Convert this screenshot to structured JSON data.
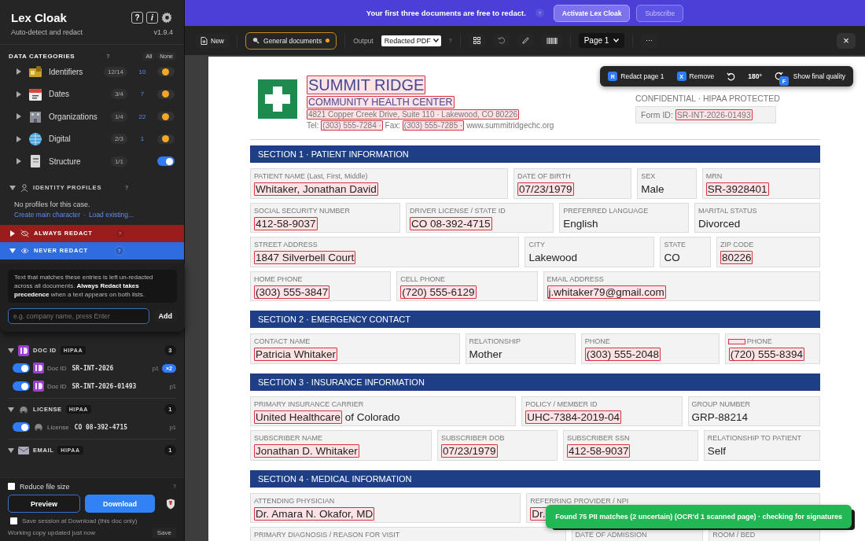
{
  "sidebar": {
    "app_title": "Lex Cloak",
    "subtitle": "Auto-detect and redact",
    "version": "v1.9.4",
    "help_button": "?",
    "info_button": "i",
    "categories_title": "DATA CATEGORIES",
    "categories_help": "?",
    "all_button": "All",
    "none_button": "None",
    "categories": [
      {
        "name": "Identifiers",
        "count": "12/14",
        "matches": "10",
        "expanded": false,
        "on": true,
        "partial": true
      },
      {
        "name": "Dates",
        "count": "3/4",
        "matches": "7",
        "expanded": false,
        "on": true,
        "partial": true
      },
      {
        "name": "Organizations",
        "count": "1/4",
        "matches": "22",
        "expanded": false,
        "on": true,
        "partial": true
      },
      {
        "name": "Digital",
        "count": "2/3",
        "matches": "1",
        "expanded": false,
        "on": true,
        "partial": true
      },
      {
        "name": "Structure",
        "count": "1/1",
        "expanded": false,
        "on": true,
        "partial": false
      }
    ],
    "profiles": {
      "title": "IDENTITY PROFILES",
      "help": "?",
      "expanded": true,
      "empty_text": "No profiles for this case.",
      "create_link": "Create main character",
      "separator": "·",
      "load_link": "Load existing..."
    },
    "always_redact": {
      "title": "ALWAYS REDACT",
      "help": "?",
      "expanded": false
    },
    "never_redact": {
      "title": "NEVER REDACT",
      "help": "?",
      "expanded": true,
      "note": "Text that matches these entries is left un-redacted across all documents. **Always Redact takes precedence** when a text appears on both lists.",
      "placeholder": "e.g. company name, press Enter",
      "add_button": "Add"
    },
    "groups": [
      {
        "title": "DOC ID",
        "tag": "HIPAA",
        "count": "3",
        "expanded": true,
        "items": [
          {
            "on": true,
            "label": "Doc ID",
            "value": "SR-INT-2026",
            "page": "p1",
            "badge": "×2"
          },
          {
            "on": true,
            "label": "Doc ID",
            "value": "SR-INT-2026-01493",
            "page": "p1"
          }
        ]
      },
      {
        "title": "LICENSE",
        "tag": "HIPAA",
        "count": "1",
        "expanded": true,
        "items": [
          {
            "on": true,
            "label": "License",
            "value": "CO 08-392-4715",
            "page": "p1"
          }
        ]
      },
      {
        "title": "EMAIL",
        "tag": "HIPAA",
        "count": "1",
        "expanded": true
      }
    ],
    "reduce_file_size": {
      "label": "Reduce file size",
      "checked": false,
      "help": "?"
    },
    "preview_button": "Preview",
    "download_button": "Download",
    "save_session": {
      "label": "Save session at Download (this doc only)",
      "checked": false
    },
    "status_text": "Working copy updated just now",
    "save_button": "Save"
  },
  "banner": {
    "text": "Your first three documents are free to redact.",
    "help": "?",
    "activate_button": "Activate Lex Cloak",
    "subscribe_button": "Subscribe"
  },
  "toolbar": {
    "new_button": "New",
    "profile_button": "General documents",
    "output_label": "Output",
    "output_value": "Redacted PDF",
    "help": "?",
    "page_value": "Page 1",
    "more_button": "⋯",
    "close_button": "×"
  },
  "floating_toolbar": {
    "redact_key": "R",
    "redact_label": "Redact page 1",
    "remove_key": "X",
    "remove_label": "Remove",
    "rotation": "180°",
    "quality_key": "F",
    "quality_label": "Show final quality"
  },
  "document": {
    "org_name": [
      {
        "text": "SUMMIT RIDGE",
        "redacted": true
      }
    ],
    "org_subtitle": [
      {
        "text": "COMMUNITY HEALTH CENTER",
        "redacted": true
      }
    ],
    "address": [
      {
        "text": "4821 Copper Creek Drive, Suite 110 · Lakewood, CO 80226",
        "redacted": true
      }
    ],
    "contact": [
      {
        "text": "Tel: ",
        "redacted": false
      },
      {
        "text": "(303) 555-7284 ·",
        "redacted": true
      },
      {
        "text": " Fax: ",
        "redacted": false
      },
      {
        "text": "(303) 555-7285 ·",
        "redacted": true
      },
      {
        "text": " www.summitridgechc.org",
        "redacted": false
      }
    ],
    "confidential": "CONFIDENTIAL · HIPAA PROTECTED",
    "form_id_label": "Form ID: ",
    "form_id": [
      {
        "text": "SR-INT-2026-01493",
        "redacted": true
      }
    ],
    "sections": [
      {
        "title": "SECTION 1 · PATIENT INFORMATION",
        "rows": [
          {
            "fields": [
              {
                "label": "PATIENT NAME (Last, First, Middle)",
                "value": [
                  {
                    "text": "Whitaker, Jonathan David",
                    "redacted": true
                  }
                ]
              },
              {
                "label": "DATE OF BIRTH",
                "value": [
                  {
                    "text": "07/23/1979",
                    "redacted": true
                  }
                ]
              },
              {
                "label": "SEX",
                "value": [
                  {
                    "text": "Male",
                    "redacted": false
                  }
                ]
              },
              {
                "label": "MRN",
                "value": [
                  {
                    "text": "SR-3928401",
                    "redacted": true
                  }
                ]
              }
            ]
          },
          {
            "fields": [
              {
                "label": "SOCIAL SECURITY NUMBER",
                "value": [
                  {
                    "text": "412-58-9037",
                    "redacted": true
                  }
                ]
              },
              {
                "label": "DRIVER LICENSE / STATE ID",
                "value": [
                  {
                    "text": "CO 08-392-4715",
                    "redacted": true
                  }
                ]
              },
              {
                "label": "PREFERRED LANGUAGE",
                "value": [
                  {
                    "text": "English",
                    "redacted": false
                  }
                ]
              },
              {
                "label": "MARITAL STATUS",
                "value": [
                  {
                    "text": "Divorced",
                    "redacted": false
                  }
                ]
              }
            ]
          },
          {
            "fields": [
              {
                "label": "STREET ADDRESS",
                "value": [
                  {
                    "text": "1847 Silverbell Court",
                    "redacted": true
                  }
                ]
              },
              {
                "label": "CITY",
                "value": [
                  {
                    "text": "Lakewood",
                    "redacted": false
                  }
                ]
              },
              {
                "label": "STATE",
                "value": [
                  {
                    "text": "CO",
                    "redacted": false
                  }
                ]
              },
              {
                "label": "ZIP CODE",
                "value": [
                  {
                    "text": "80226",
                    "redacted": true
                  }
                ]
              }
            ]
          },
          {
            "fields": [
              {
                "label": "HOME PHONE",
                "value": [
                  {
                    "text": "(303) 555-3847",
                    "redacted": true
                  }
                ]
              },
              {
                "label": "CELL PHONE",
                "value": [
                  {
                    "text": "(720) 555-6129",
                    "redacted": true
                  }
                ]
              },
              {
                "label": "EMAIL ADDRESS",
                "value": [
                  {
                    "text": "j.whitaker79@gmail.com",
                    "redacted": true
                  }
                ]
              }
            ]
          }
        ]
      },
      {
        "title": "SECTION 2 · EMERGENCY CONTACT",
        "rows": [
          {
            "fields": [
              {
                "label": "CONTACT NAME",
                "value": [
                  {
                    "text": "Patricia Whitaker",
                    "redacted": true
                  }
                ]
              },
              {
                "label": "RELATIONSHIP",
                "value": [
                  {
                    "text": "Mother",
                    "redacted": false
                  }
                ]
              },
              {
                "label": "PHONE",
                "value": [
                  {
                    "text": "(303) 555-2048",
                    "redacted": true
                  }
                ]
              },
              {
                "label": "PHONE",
                "label_redacted": true,
                "value": [
                  {
                    "text": "(720) 555-8394",
                    "redacted": true
                  }
                ]
              }
            ]
          }
        ]
      },
      {
        "title": "SECTION 3 · INSURANCE INFORMATION",
        "rows": [
          {
            "fields": [
              {
                "label": "PRIMARY INSURANCE CARRIER",
                "value": [
                  {
                    "text": "United Healthcare",
                    "redacted": true
                  },
                  {
                    "text": " of Colorado",
                    "redacted": false
                  }
                ]
              },
              {
                "label": "POLICY / MEMBER ID",
                "value": [
                  {
                    "text": "UHC-7384-2019-04",
                    "redacted": true
                  }
                ]
              },
              {
                "label": "GROUP NUMBER",
                "value": [
                  {
                    "text": "GRP-88214",
                    "redacted": false
                  }
                ]
              }
            ]
          },
          {
            "fields": [
              {
                "label": "SUBSCRIBER NAME",
                "value": [
                  {
                    "text": "Jonathan D. Whitaker",
                    "redacted": true
                  }
                ]
              },
              {
                "label": "SUBSCRIBER DOB",
                "value": [
                  {
                    "text": "07/23/1979",
                    "redacted": true
                  }
                ]
              },
              {
                "label": "SUBSCRIBER SSN",
                "value": [
                  {
                    "text": "412-58-9037",
                    "redacted": true
                  }
                ]
              },
              {
                "label": "RELATIONSHIP TO PATIENT",
                "value": [
                  {
                    "text": "Self",
                    "redacted": false
                  }
                ]
              }
            ]
          }
        ]
      },
      {
        "title": "SECTION 4 · MEDICAL INFORMATION",
        "rows": [
          {
            "fields": [
              {
                "label": "ATTENDING PHYSICIAN",
                "value": [
                  {
                    "text": "Dr. Amara N. Okafor, MD",
                    "redacted": true
                  }
                ]
              },
              {
                "label": "REFERRING PROVIDER / NPI",
                "value": [
                  {
                    "text": "Dr.",
                    "redacted": true
                  }
                ]
              }
            ]
          },
          {
            "fields": [
              {
                "label": "PRIMARY DIAGNOSIS / REASON FOR VISIT"
              },
              {
                "label": "DATE OF ADMISSION"
              },
              {
                "label": "ROOM / BED"
              }
            ]
          }
        ]
      }
    ]
  },
  "toast": "Found 75 PII matches (2 uncertain) (OCR'd 1 scanned page) · checking for signatures"
}
